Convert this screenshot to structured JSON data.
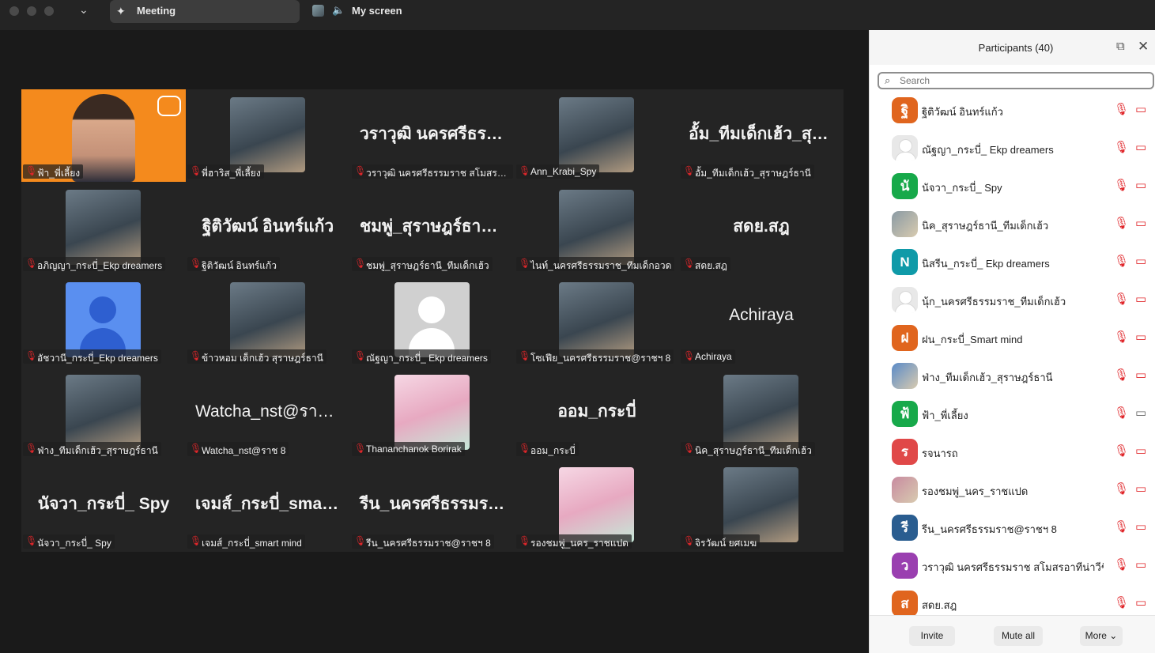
{
  "topbar": {
    "tab_meeting_label": "Meeting",
    "share_label": "My screen"
  },
  "gallery": {
    "tiles": [
      {
        "name": "ฟ้า_พี่เลี้ยง",
        "kind": "video-orange",
        "speaking": true
      },
      {
        "name": "พี่ฮาริส_พี่เลี้ยง",
        "kind": "photo"
      },
      {
        "name": "วราวุฒิ นครศรีธรรมราช สโมสรอ...",
        "kind": "text",
        "big": "วราวุฒิ นครศรีธรร..."
      },
      {
        "name": "Ann_Krabi_Spy",
        "kind": "photo"
      },
      {
        "name": "อั้ม_ทีมเด็กเฮ้ว_สุราษฎร์ธานี",
        "kind": "text",
        "big": "อั้ม_ทีมเด็กเฮ้ว_สุรา..."
      },
      {
        "name": "อภิญญา_กระบี่_Ekp dreamers",
        "kind": "photo"
      },
      {
        "name": "ฐิติวัฒน์ อินทร์แก้ว",
        "kind": "text",
        "big": "ฐิติวัฒน์ อินทร์แก้ว"
      },
      {
        "name": "ชมพู่_สุราษฎร์ธานี_ทีมเด็กเฮ้ว",
        "kind": "text",
        "big": "ชมพู่_สุราษฎร์ธานี_..."
      },
      {
        "name": "ไนท์_นครศรีธรรมราช_ทีมเด็กอวด",
        "kind": "photo"
      },
      {
        "name": "สดย.สฎ",
        "kind": "text",
        "big": "สดย.สฎ"
      },
      {
        "name": "อัชวานี_กระบี่_Ekp dreamers",
        "kind": "avatar-blue"
      },
      {
        "name": "ข้าวหอม เด็กเฮ้ว สุราษฎร์ธานี",
        "kind": "photo"
      },
      {
        "name": "ณัฐญา_กระบี่_ Ekp dreamers",
        "kind": "avatar-grey"
      },
      {
        "name": "โซเฟีย_นครศรีธรรมราช@ราชฯ 8",
        "kind": "photo"
      },
      {
        "name": "Achiraya",
        "kind": "text-plain",
        "big": "Achiraya"
      },
      {
        "name": "ฟ่าง_ทีมเด็กเฮ้ว_สุราษฎร์ธานี",
        "kind": "photo"
      },
      {
        "name": "Watcha_nst@ราช 8",
        "kind": "text-plain",
        "big": "Watcha_nst@ราช 8"
      },
      {
        "name": "Thananchanok Borirak",
        "kind": "photo-pink"
      },
      {
        "name": "ออม_กระบี่",
        "kind": "text",
        "big": "ออม_กระบี่"
      },
      {
        "name": "นิค_สุราษฎร์ธานี_ทีมเด็กเฮ้ว",
        "kind": "photo"
      },
      {
        "name": "นัจวา_กระบี่_ Spy",
        "kind": "text",
        "big": "นัจวา_กระบี่_ Spy"
      },
      {
        "name": "เจมส์_กระบี่_smart mind",
        "kind": "text",
        "big": "เจมส์_กระบี่_smart..."
      },
      {
        "name": "รีน_นครศรีธรรมราช@ราชฯ 8",
        "kind": "text",
        "big": "รีน_นครศรีธรรมรา..."
      },
      {
        "name": "รองชมพู่_นคร_ราชแปด",
        "kind": "photo-pink"
      },
      {
        "name": "จิรวัฒน์ ยศเมฆ",
        "kind": "photo"
      }
    ]
  },
  "panel": {
    "title": "Participants (40)",
    "search_placeholder": "Search",
    "participants": [
      {
        "name": "ฐิติวัฒน์ อินทร์แก้ว",
        "initial": "ฐิ",
        "color": "#e0651e",
        "avatar": "initial",
        "cam_on": false
      },
      {
        "name": "ณัฐญา_กระบี่_ Ekp dreamers",
        "initial": "",
        "color": "#e8e8e8",
        "avatar": "placeholder",
        "cam_on": false
      },
      {
        "name": "นัจวา_กระบี่_ Spy",
        "initial": "นั",
        "color": "#17a94a",
        "avatar": "initial",
        "cam_on": false
      },
      {
        "name": "นิค_สุราษฎร์ธานี_ทีมเด็กเฮ้ว",
        "initial": "",
        "color": "#8a9aa4",
        "avatar": "photo",
        "cam_on": false
      },
      {
        "name": "นิสรีน_กระบี่_ Ekp dreamers",
        "initial": "N",
        "color": "#0f9aa8",
        "avatar": "initial",
        "cam_on": false
      },
      {
        "name": "นุ้ก_นครศรีธรรมราช_ทีมเด็กเฮ้ว",
        "initial": "",
        "color": "#e8e8e8",
        "avatar": "placeholder",
        "cam_on": false
      },
      {
        "name": "ฝน_กระบี่_Smart mind",
        "initial": "ฝ",
        "color": "#e0651e",
        "avatar": "initial",
        "cam_on": false
      },
      {
        "name": "ฟ่าง_ทีมเด็กเฮ้ว_สุราษฎร์ธานี",
        "initial": "",
        "color": "#5a8ac8",
        "avatar": "photo",
        "cam_on": false
      },
      {
        "name": "ฟ้า_พี่เลี้ยง",
        "initial": "ฟ้",
        "color": "#17a94a",
        "avatar": "initial",
        "cam_on": true
      },
      {
        "name": "รจนารถ",
        "initial": "ร",
        "color": "#e04848",
        "avatar": "initial",
        "cam_on": false
      },
      {
        "name": "รองชมพู่_นคร_ราชแปด",
        "initial": "",
        "color": "#c88aa0",
        "avatar": "photo",
        "cam_on": false
      },
      {
        "name": "รีน_นครศรีธรรมราช@ราชฯ 8",
        "initial": "รี",
        "color": "#2a5d90",
        "avatar": "initial",
        "cam_on": false
      },
      {
        "name": "วราวุฒิ นครศรีธรรมราช สโมสรอาทีน่าวีชี",
        "initial": "ว",
        "color": "#9a3fb0",
        "avatar": "initial",
        "cam_on": false
      },
      {
        "name": "สดย.สฎ",
        "initial": "ส",
        "color": "#e0651e",
        "avatar": "initial",
        "cam_on": false
      }
    ],
    "footer": {
      "invite_label": "Invite",
      "mute_all_label": "Mute all",
      "more_label": "More"
    }
  }
}
